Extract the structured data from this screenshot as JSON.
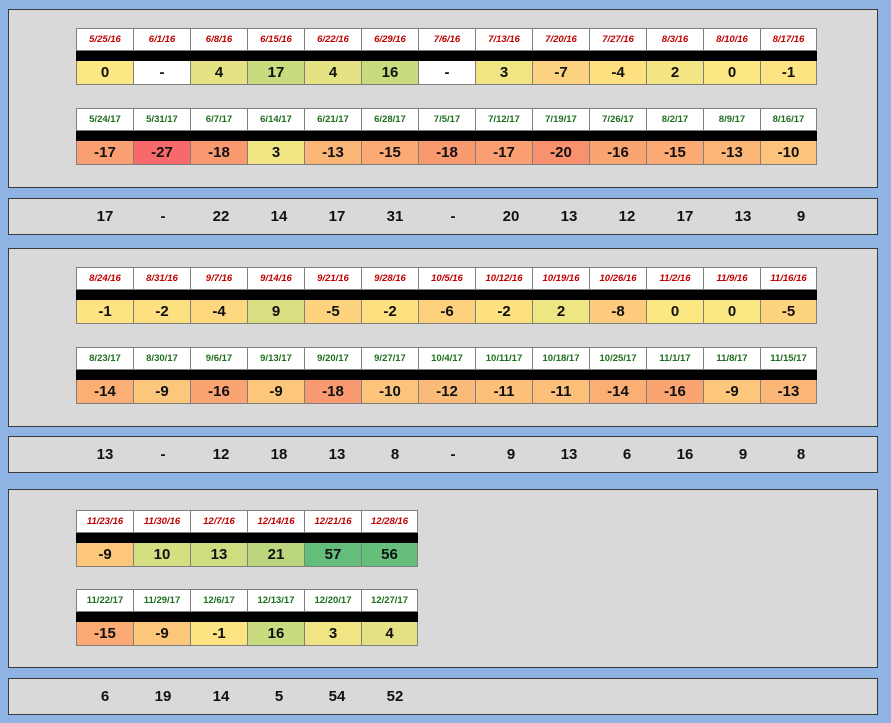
{
  "colors": {
    "background": "#8fb4e3",
    "panel": "#d9d9d9",
    "date_2016": "#c00000",
    "date_2017": "#1e6e1e"
  },
  "sections": [
    {
      "r2016": {
        "dates": [
          "5/25/16",
          "6/1/16",
          "6/8/16",
          "6/15/16",
          "6/22/16",
          "6/29/16",
          "7/6/16",
          "7/13/16",
          "7/20/16",
          "7/27/16",
          "8/3/16",
          "8/10/16",
          "8/17/16"
        ],
        "values": [
          "0",
          "-",
          "4",
          "17",
          "4",
          "16",
          "-",
          "3",
          "-7",
          "-4",
          "2",
          "0",
          "-1"
        ],
        "colors": [
          "#fce883",
          "#ffffff",
          "#e4e282",
          "#c9db7f",
          "#e4e282",
          "#c9db7f",
          "#ffffff",
          "#f0e582",
          "#fcd17f",
          "#fde080",
          "#f3e583",
          "#fce883",
          "#fde382"
        ]
      },
      "r2017": {
        "dates": [
          "5/24/17",
          "5/31/17",
          "6/7/17",
          "6/14/17",
          "6/21/17",
          "6/28/17",
          "7/5/17",
          "7/12/17",
          "7/19/17",
          "7/26/17",
          "8/2/17",
          "8/9/17",
          "8/16/17"
        ],
        "values": [
          "-17",
          "-27",
          "-18",
          "3",
          "-13",
          "-15",
          "-18",
          "-17",
          "-20",
          "-16",
          "-15",
          "-13",
          "-10"
        ],
        "colors": [
          "#fa9f71",
          "#f8696b",
          "#f99970",
          "#f0e582",
          "#fbb576",
          "#fbaa74",
          "#f99970",
          "#fa9f71",
          "#f9906e",
          "#faa472",
          "#fbaa74",
          "#fbb576",
          "#fcc47a"
        ]
      },
      "summary": [
        "17",
        "-",
        "22",
        "14",
        "17",
        "31",
        "-",
        "20",
        "13",
        "12",
        "17",
        "13",
        "9"
      ]
    },
    {
      "r2016": {
        "dates": [
          "8/24/16",
          "8/31/16",
          "9/7/16",
          "9/14/16",
          "9/21/16",
          "9/28/16",
          "10/5/16",
          "10/12/16",
          "10/19/16",
          "10/26/16",
          "11/2/16",
          "11/9/16",
          "11/16/16"
        ],
        "values": [
          "-1",
          "-2",
          "-4",
          "9",
          "-5",
          "-2",
          "-6",
          "-2",
          "2",
          "-8",
          "0",
          "0",
          "-5"
        ],
        "colors": [
          "#fde382",
          "#fde080",
          "#fdd87e",
          "#d9df81",
          "#fdd47d",
          "#fde080",
          "#fdd07c",
          "#fde080",
          "#eee683",
          "#fccb7b",
          "#fce883",
          "#fce883",
          "#fdd47d"
        ]
      },
      "r2017": {
        "dates": [
          "8/23/17",
          "8/30/17",
          "9/6/17",
          "9/13/17",
          "9/20/17",
          "9/27/17",
          "10/4/17",
          "10/11/17",
          "10/18/17",
          "10/25/17",
          "11/1/17",
          "11/8/17",
          "11/15/17"
        ],
        "values": [
          "-14",
          "-9",
          "-16",
          "-9",
          "-18",
          "-10",
          "-12",
          "-11",
          "-11",
          "-14",
          "-16",
          "-9",
          "-13"
        ],
        "colors": [
          "#fbaf75",
          "#fcc77b",
          "#faa472",
          "#fcc77b",
          "#f99970",
          "#fcc47a",
          "#fbbb78",
          "#fcc07a",
          "#fcc07a",
          "#fbaf75",
          "#faa472",
          "#fcc77b",
          "#fbb576"
        ]
      },
      "summary": [
        "13",
        "-",
        "12",
        "18",
        "13",
        "8",
        "-",
        "9",
        "13",
        "6",
        "16",
        "9",
        "8"
      ]
    },
    {
      "r2016": {
        "dates": [
          "11/23/16",
          "11/30/16",
          "12/7/16",
          "12/14/16",
          "12/21/16",
          "12/28/16"
        ],
        "values": [
          "-9",
          "10",
          "13",
          "21",
          "57",
          "56"
        ],
        "colors": [
          "#fcc77b",
          "#d5de81",
          "#cfdc80",
          "#bcd67e",
          "#63be7b",
          "#65bf7b"
        ]
      },
      "r2017": {
        "dates": [
          "11/22/17",
          "11/29/17",
          "12/6/17",
          "12/13/17",
          "12/20/17",
          "12/27/17"
        ],
        "values": [
          "-15",
          "-9",
          "-1",
          "16",
          "3",
          "4"
        ],
        "colors": [
          "#fbaa74",
          "#fcc77b",
          "#fde382",
          "#c9db7f",
          "#f0e582",
          "#e4e282"
        ]
      },
      "summary": [
        "6",
        "19",
        "14",
        "5",
        "54",
        "52"
      ]
    }
  ]
}
